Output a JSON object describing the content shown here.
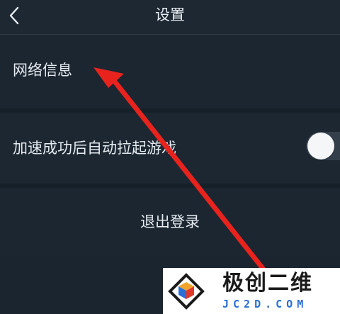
{
  "header": {
    "title": "设置",
    "back_icon": "chevron-left-icon"
  },
  "settings": {
    "network_info_label": "网络信息",
    "auto_launch_label": "加速成功后自动拉起游戏",
    "auto_launch_enabled": false,
    "logout_label": "退出登录"
  },
  "overlay": {
    "arrow_color": "#e8231d"
  },
  "watermark": {
    "brand": "极创二维",
    "domain": "JC2D.COM"
  },
  "colors": {
    "background": "#1a2530",
    "text": "#e6ebf0"
  }
}
